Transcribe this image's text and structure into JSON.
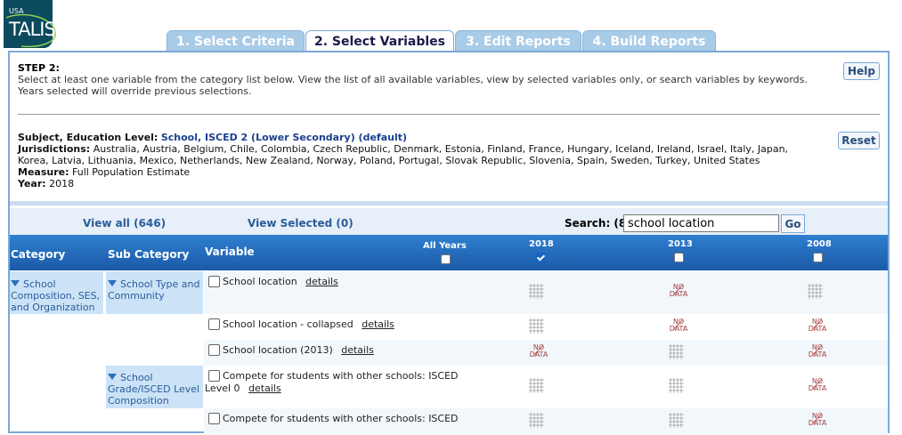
{
  "logo": {
    "small": "USA",
    "name": "TALIS"
  },
  "tabs": [
    {
      "label": "1. Select Criteria",
      "state": "inactive"
    },
    {
      "label": "2. Select Variables",
      "state": "active"
    },
    {
      "label": "3. Edit Reports",
      "state": "inactive"
    },
    {
      "label": "4. Build Reports",
      "state": "inactive"
    }
  ],
  "step": {
    "title": "STEP 2:",
    "text": "Select at least one variable from the category list below. View the list of all available variables, view by selected variables only, or search variables by keywords. Years selected will override previous selections.",
    "help_label": "Help"
  },
  "criteria": {
    "subject_label": "Subject, Education Level:",
    "subject_value": "School, ISCED 2 (Lower Secondary) (default)",
    "jur_label": "Jurisdictions:",
    "jur_value": "Australia, Austria, Belgium, Chile, Colombia, Czech Republic, Denmark, Estonia, Finland, France, Hungary, Iceland, Ireland, Israel, Italy, Japan, Korea, Latvia, Lithuania, Mexico, Netherlands, New Zealand, Norway, Poland, Portugal, Slovak Republic, Slovenia, Spain, Sweden, Turkey, United States",
    "measure_label": "Measure:",
    "measure_value": "Full Population Estimate",
    "year_label": "Year:",
    "year_value": "2018",
    "reset_label": "Reset"
  },
  "toolbar": {
    "view_all": "View all (646)",
    "view_selected": "View Selected (0)",
    "search_label": "Search: (8)",
    "search_value": "school location",
    "go_label": "Go"
  },
  "table": {
    "headers": {
      "category": "Category",
      "subcategory": "Sub Category",
      "variable": "Variable",
      "all_years": "All Years",
      "y2018": "2018",
      "y2013": "2013",
      "y2008": "2008"
    },
    "year_checked": {
      "all_years": false,
      "y2018": true,
      "y2013": false,
      "y2008": false
    },
    "details_label": "details",
    "nodata_line1": "NO",
    "nodata_line2": "DATA",
    "category": "School Composition, SES, and Organization",
    "subcategory_1": "School Type and Community",
    "subcategory_2": "School Grade/ISCED Level Composition",
    "rows": [
      {
        "variable": "School location",
        "y2018": "available",
        "y2013": "nodata",
        "y2008": "available"
      },
      {
        "variable": "School location - collapsed",
        "y2018": "available",
        "y2013": "nodata",
        "y2008": "nodata"
      },
      {
        "variable": "School location (2013)",
        "y2018": "nodata",
        "y2013": "available",
        "y2008": "nodata"
      },
      {
        "variable": "Compete for students with other schools: ISCED Level 0",
        "y2018": "available",
        "y2013": "available",
        "y2008": "nodata"
      },
      {
        "variable": "Compete for students with other schools: ISCED",
        "y2018": "available",
        "y2013": "available",
        "y2008": "nodata"
      }
    ]
  },
  "colors": {
    "accent": "#1b5aa8",
    "tab_inactive": "#a8cbe8",
    "category_bg": "#cce3f7"
  }
}
